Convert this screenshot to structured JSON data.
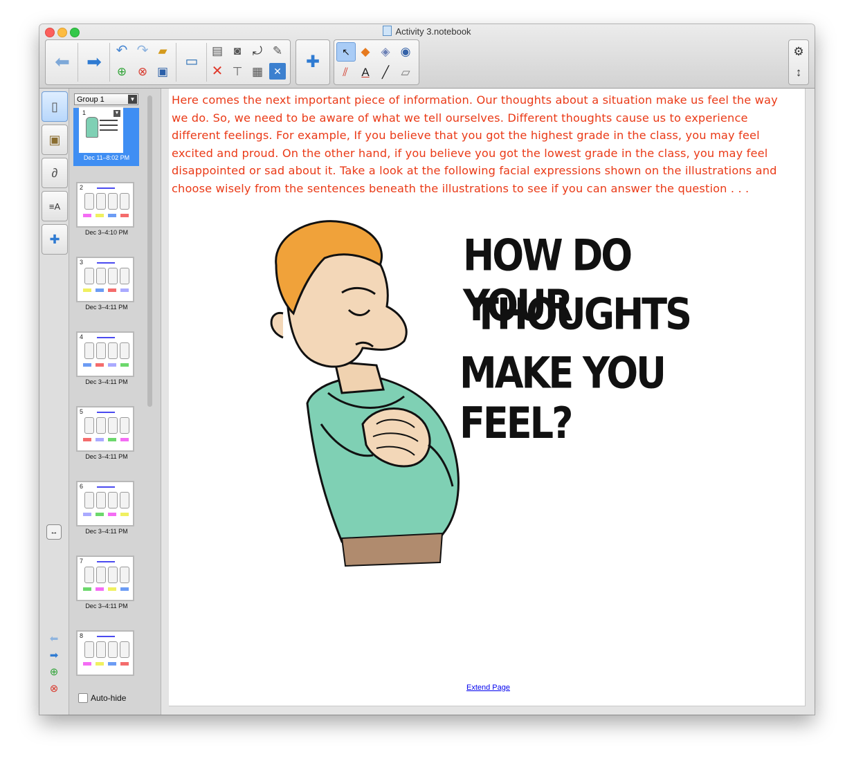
{
  "window": {
    "title": "Activity 3.notebook"
  },
  "toolbar": {
    "icons": [
      "back-icon",
      "forward-icon",
      "undo-icon",
      "redo-icon",
      "open-icon",
      "add-page-icon",
      "delete-page-icon",
      "save-icon",
      "display-icon",
      "paste-icon",
      "screen-capture-icon",
      "rotate-icon",
      "properties-icon",
      "delete-icon",
      "screen-shade-icon",
      "table-icon",
      "clear-icon",
      "addons-icon",
      "select-icon",
      "shapes-icon",
      "magic-pen-icon",
      "fill-icon",
      "pens-icon",
      "text-icon",
      "line-icon",
      "eraser-icon",
      "settings-icon",
      "move-toolbar-icon"
    ]
  },
  "sidebar": {
    "tabs": [
      "page-sorter",
      "gallery",
      "attachments",
      "properties",
      "addons"
    ],
    "auto_hide_label": "Auto-hide"
  },
  "sorter": {
    "group_label": "Group 1",
    "pages": [
      {
        "num": "1",
        "time": "Dec 11–8:02 PM",
        "selected": true
      },
      {
        "num": "2",
        "time": "Dec 3–4:10 PM"
      },
      {
        "num": "3",
        "time": "Dec 3–4:11 PM"
      },
      {
        "num": "4",
        "time": "Dec 3–4:11 PM"
      },
      {
        "num": "5",
        "time": "Dec 3–4:11 PM"
      },
      {
        "num": "6",
        "time": "Dec 3–4:11 PM"
      },
      {
        "num": "7",
        "time": "Dec 3–4:11 PM"
      },
      {
        "num": "8",
        "time": ""
      }
    ]
  },
  "page": {
    "text_lines": [
      "Here comes the next important piece of information.  Our thoughts about a situation make us feel the way",
      "we do.  So, we need to be aware of what we tell ourselves.  Different thoughts cause us to experience",
      "different feelings.  For example, If you believe that you got the highest grade in the class, you may feel",
      "excited and proud.  On the other hand, if you believe you got the lowest grade in the class, you may feel",
      "disappointed or sad about it.  Take a look at the following facial expressions shown on the illustrations and",
      "choose wisely from the sentences beneath the illustrations to see if you can answer the question . . ."
    ],
    "illustration_title": [
      "HOW DO YOUR",
      "THOUGHTS",
      "MAKE YOU FEEL?"
    ],
    "extend_label": "Extend Page"
  },
  "colors": {
    "text": "#ea3a17",
    "accent": "#2f7bd2",
    "selection": "#3f8ef3"
  }
}
